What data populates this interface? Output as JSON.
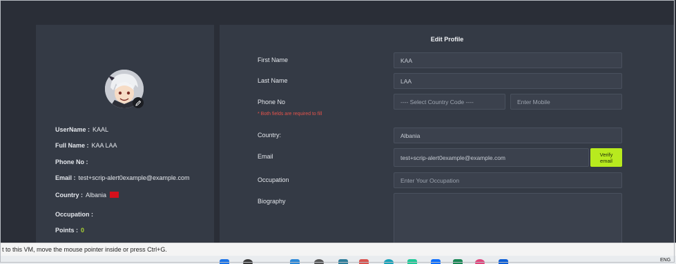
{
  "profile_summary": {
    "username_label": "UserName :",
    "username_value": "KAAL",
    "fullname_label": "Full Name :",
    "fullname_value": "KAA LAA",
    "phone_label": "Phone No :",
    "email_label": "Email :",
    "email_value": "test+scrip-alert0example@example.com",
    "country_label": "Country :",
    "country_value": "Albania",
    "occupation_label": "Occupation :",
    "points_label": "Points :",
    "points_value": "0"
  },
  "edit_form": {
    "title": "Edit Profile",
    "first_name_label": "First Name",
    "first_name_value": "KAA",
    "last_name_label": "Last Name",
    "last_name_value": "LAA",
    "phone_label": "Phone No",
    "required_note": "* Both fields are required to fill",
    "country_code_placeholder": "---- Select Country Code ----",
    "mobile_placeholder": "Enter Mobile",
    "country_label": "Country:",
    "country_value": "Albania",
    "email_label": "Email",
    "email_value": "test+scrip-alert0example@example.com",
    "verify_line1": "Verify",
    "verify_line2": "email",
    "occupation_label": "Occupation",
    "occupation_placeholder": "Enter Your Occupation",
    "biography_label": "Biography"
  },
  "vm_bar": {
    "text": "t to this VM, move the mouse pointer inside or press Ctrl+G."
  },
  "taskbar": {
    "lang": "ENG"
  },
  "colors": {
    "page_bg": "#2a2e37",
    "card_bg": "#343a45",
    "input_bg": "#3b414d",
    "accent_green": "#b8ea1e",
    "error_red": "#e5534b"
  }
}
